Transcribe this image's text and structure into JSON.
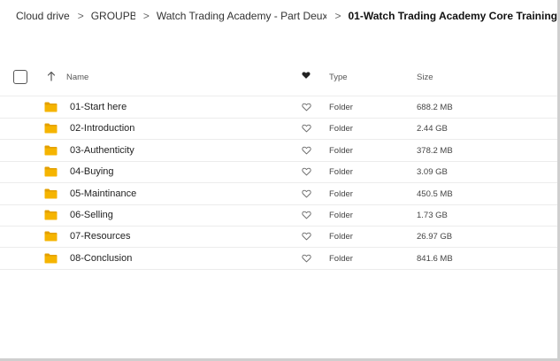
{
  "breadcrumb": [
    {
      "label": "Cloud drive"
    },
    {
      "label": "GROUPBUY"
    },
    {
      "label": "Watch Trading Academy - Part Deux Advanced"
    },
    {
      "label": "01-Watch Trading Academy Core Training"
    }
  ],
  "separator": ">",
  "header": {
    "name": "Name",
    "type": "Type",
    "size": "Size"
  },
  "rows": [
    {
      "name": "01-Start here",
      "type": "Folder",
      "size": "688.2 MB"
    },
    {
      "name": "02-Introduction",
      "type": "Folder",
      "size": "2.44 GB"
    },
    {
      "name": "03-Authenticity",
      "type": "Folder",
      "size": "378.2 MB"
    },
    {
      "name": "04-Buying",
      "type": "Folder",
      "size": "3.09 GB"
    },
    {
      "name": "05-Maintinance",
      "type": "Folder",
      "size": "450.5 MB"
    },
    {
      "name": "06-Selling",
      "type": "Folder",
      "size": "1.73 GB"
    },
    {
      "name": "07-Resources",
      "type": "Folder",
      "size": "26.97 GB"
    },
    {
      "name": "08-Conclusion",
      "type": "Folder",
      "size": "841.6 MB"
    }
  ],
  "icons": {
    "folder": "folder-icon",
    "favourite": "heart-icon",
    "sort": "arrow-up-icon"
  },
  "colors": {
    "folder": "#f5b400",
    "folder_tab": "#e3a000",
    "heart_outline": "#666666",
    "heart_filled": "#222222"
  }
}
